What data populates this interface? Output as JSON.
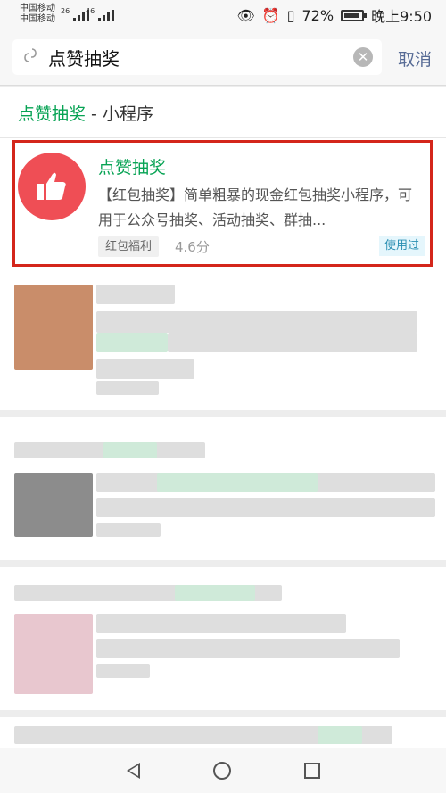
{
  "status_bar": {
    "carrier_1": "中国移动",
    "carrier_2": "中国移动",
    "net_1": "26",
    "net_2": "46",
    "battery": "72%",
    "time": "晚上9:50"
  },
  "search": {
    "value": "点赞抽奖",
    "cancel_label": "取消"
  },
  "section": {
    "keyword": "点赞抽奖",
    "suffix": " - 小程序"
  },
  "result": {
    "name": "点赞抽奖",
    "description": "【红包抽奖】简单粗暴的现金红包抽奖小程序，可用于公众号抽奖、活动抽奖、群抽...",
    "tag": "红包福利",
    "rating": "4.6分",
    "badge": "使用过"
  },
  "colors": {
    "accent": "#07a354",
    "link": "#576b95",
    "logo_bg": "#ef4e55",
    "highlight_border": "#d4261b"
  },
  "icons": [
    "search-icon",
    "clear-icon",
    "thumbs-up-icon",
    "nav-back-icon",
    "nav-home-icon",
    "nav-recent-icon"
  ]
}
